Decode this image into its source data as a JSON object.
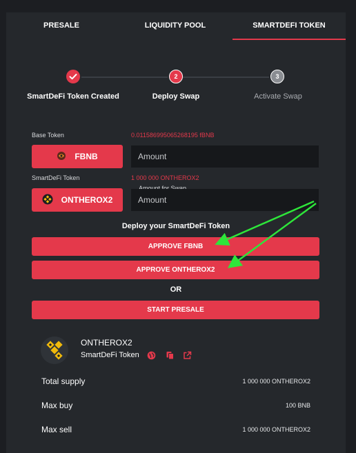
{
  "tabs": [
    "PRESALE",
    "LIQUIDITY POOL",
    "SMARTDEFI TOKEN"
  ],
  "active_tab": "SMARTDEFI TOKEN",
  "accent_color": "#e4394b",
  "steps": [
    {
      "number": "",
      "label": "SmartDeFi Token Created",
      "state": "done"
    },
    {
      "number": "2",
      "label": "Deploy Swap",
      "state": "active"
    },
    {
      "number": "3",
      "label": "Activate Swap",
      "state": "pending"
    }
  ],
  "base": {
    "label": "Base Token",
    "balance": "0.011586995065268195 fBNB",
    "token_button": "FBNB",
    "amount_placeholder": "Amount"
  },
  "smartdefi": {
    "label": "SmartDeFi Token",
    "balance": "1 000 000 ONTHEROX2",
    "token_button": "ONTHEROX2",
    "hint": "Amount for Swap",
    "amount_placeholder": "Amount"
  },
  "deploy_title": "Deploy your SmartDeFi Token",
  "buttons": {
    "approve_fbnb": "APPROVE FBNB",
    "approve_ontherox2": "APPROVE ONTHEROX2",
    "or": "OR",
    "start_presale": "START PRESALE"
  },
  "token_card": {
    "name": "ONTHEROX2",
    "subtitle": "SmartDeFi Token",
    "icons": [
      "globe-icon",
      "copy-icon",
      "external-link-icon"
    ]
  },
  "info": [
    {
      "key": "Total supply",
      "value": "1 000 000 ONTHEROX2"
    },
    {
      "key": "Max buy",
      "value": "100 BNB"
    },
    {
      "key": "Max sell",
      "value": "1 000 000 ONTHEROX2"
    }
  ]
}
